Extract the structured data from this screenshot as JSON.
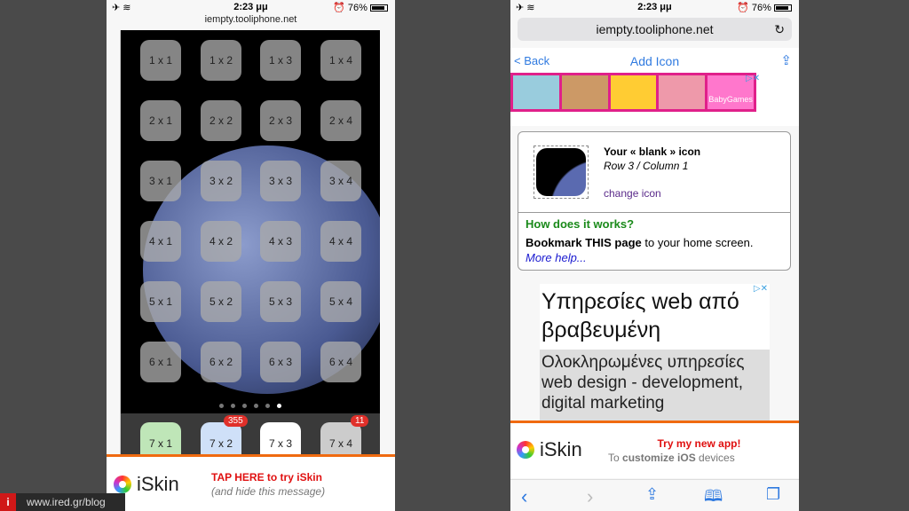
{
  "left": {
    "status": {
      "time": "2:23 μμ",
      "battery": "76%"
    },
    "url": "iempty.tooliphone.net",
    "grid": [
      [
        "1 x 1",
        "1 x 2",
        "1 x 3",
        "1 x 4"
      ],
      [
        "2 x 1",
        "2 x 2",
        "2 x 3",
        "2 x 4"
      ],
      [
        "3 x 1",
        "3 x 2",
        "3 x 3",
        "3 x 4"
      ],
      [
        "4 x 1",
        "4 x 2",
        "4 x 3",
        "4 x 4"
      ],
      [
        "5 x 1",
        "5 x 2",
        "5 x 3",
        "5 x 4"
      ],
      [
        "6 x 1",
        "6 x 2",
        "6 x 3",
        "6 x 4"
      ]
    ],
    "dock": [
      {
        "label": "7 x 1"
      },
      {
        "label": "7 x 2",
        "badge": "355"
      },
      {
        "label": "7 x 3"
      },
      {
        "label": "7 x 4",
        "badge": "11"
      }
    ],
    "banner": {
      "brand": "iSkin",
      "cta": "TAP HERE to try iSkin",
      "sub": "(and hide this message)"
    }
  },
  "watermark": {
    "letter": "i",
    "text": "www.ired.gr/blog"
  },
  "right": {
    "status": {
      "time": "2:23 μμ",
      "battery": "76%"
    },
    "url": "iempty.tooliphone.net",
    "nav": {
      "back": "< Back",
      "title": "Add Icon"
    },
    "card": {
      "title": "Your « blank » icon",
      "position": "Row 3 / Column 1",
      "change": "change icon",
      "how": "How does it works?",
      "bookmark_bold": "Bookmark THIS page",
      "bookmark_rest": " to your home screen.",
      "more": "More help..."
    },
    "ad": {
      "headline": "Υπηρεσίες web από βραβευμένη",
      "body": "Ολοκληρωμένες υπηρεσίες web design - development, digital marketing",
      "brand_banner": "BabyGames"
    },
    "banner": {
      "brand": "iSkin",
      "cta": "Try my new app!",
      "sub_pre": "To ",
      "sub_bold": "customize iOS",
      "sub_post": " devices"
    }
  },
  "colors": {
    "orange": "#f06a10",
    "link": "#2f7ae0",
    "green": "#1a8a1a"
  }
}
